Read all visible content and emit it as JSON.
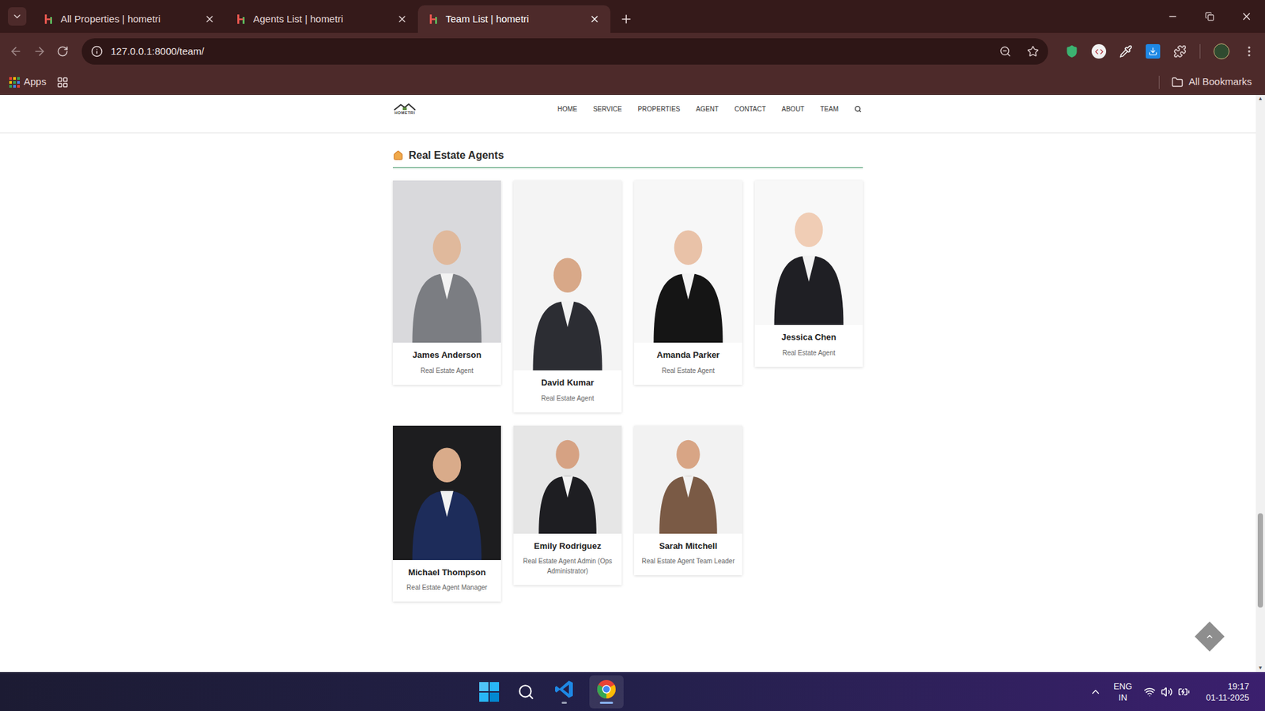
{
  "browser": {
    "tabs": [
      {
        "label": "All Properties | hometri",
        "selected": false
      },
      {
        "label": "Agents List | hometri",
        "selected": false
      },
      {
        "label": "Team List | hometri",
        "selected": true
      }
    ],
    "address": "127.0.0.1:8000/team/",
    "bookmarks": [
      {
        "label": "Apps"
      }
    ],
    "all_bookmarks": "All Bookmarks"
  },
  "site": {
    "logo": "HOMETRI",
    "nav": [
      "HOME",
      "SERVICE",
      "PROPERTIES",
      "AGENT",
      "CONTACT",
      "ABOUT",
      "TEAM"
    ],
    "section_title": "Real Estate Agents",
    "agents": [
      {
        "name": "James Anderson",
        "role": "Real Estate Agent"
      },
      {
        "name": "David Kumar",
        "role": "Real Estate Agent"
      },
      {
        "name": "Amanda Parker",
        "role": "Real Estate Agent"
      },
      {
        "name": "Jessica Chen",
        "role": "Real Estate Agent"
      },
      {
        "name": "Michael Thompson",
        "role": "Real Estate Agent Manager"
      },
      {
        "name": "Emily Rodriguez",
        "role": "Real Estate Agent Admin (Ops Administrator)"
      },
      {
        "name": "Sarah Mitchell",
        "role": "Real Estate Agent Team Leader"
      }
    ]
  },
  "taskbar": {
    "language": "ENG",
    "region": "IN",
    "time": "19:17",
    "date": "01-11-2025"
  }
}
